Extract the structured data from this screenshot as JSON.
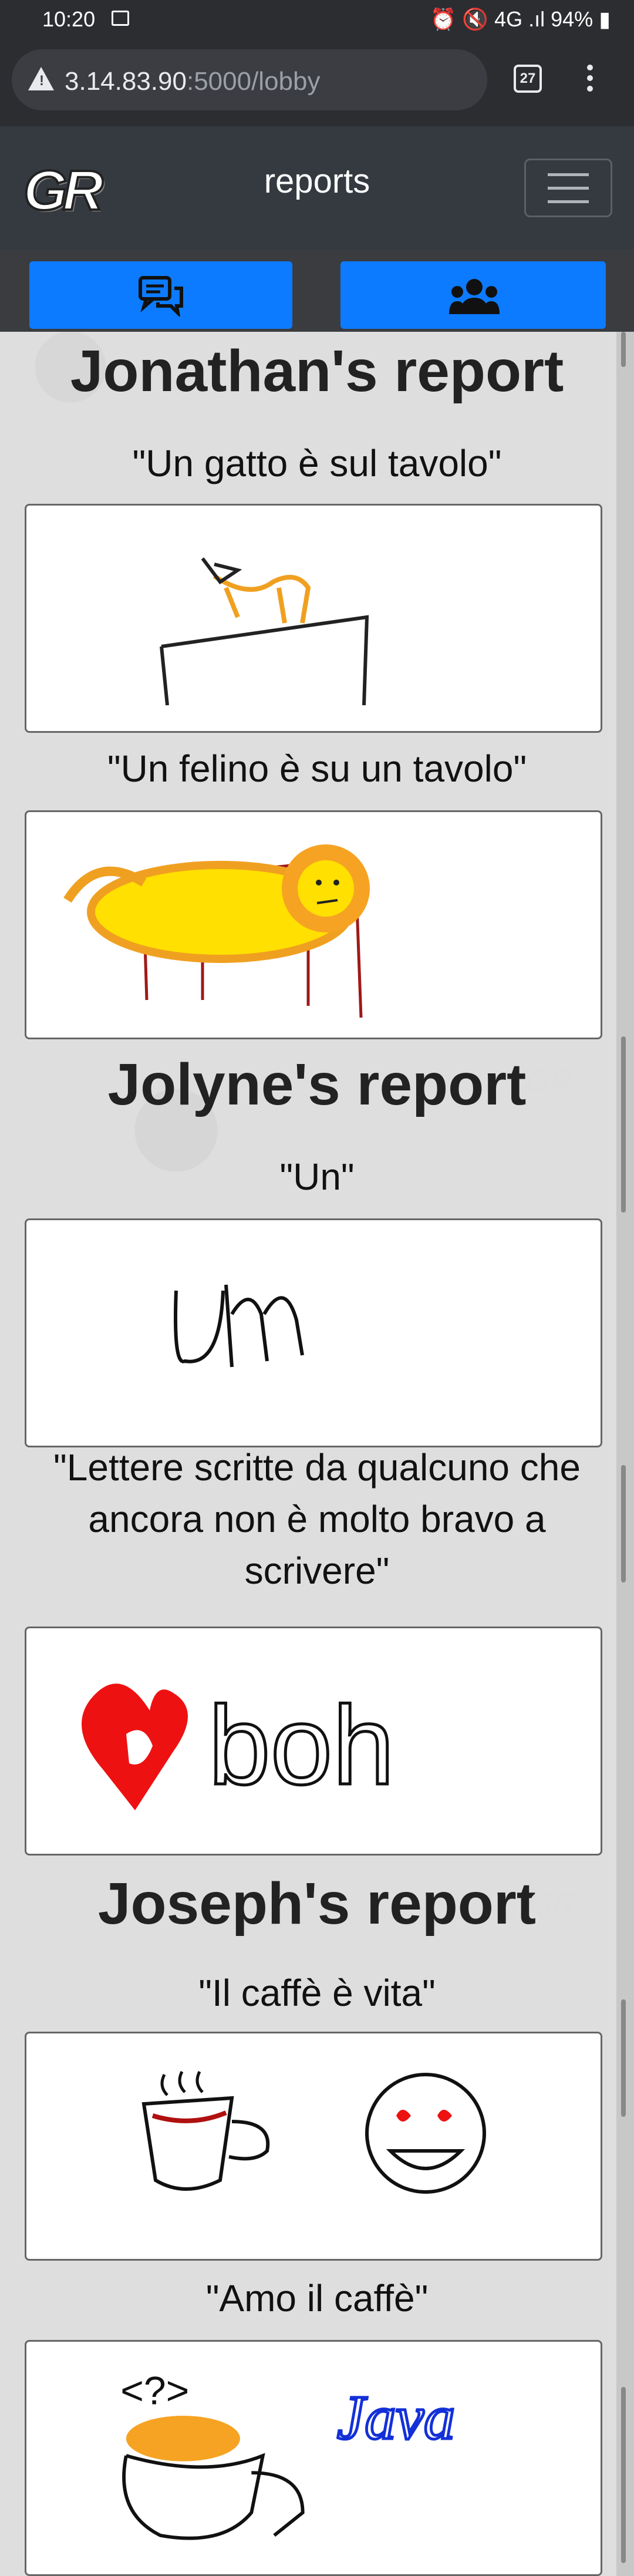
{
  "status": {
    "time": "10:20",
    "right": "⏰ 🔇 4G .ıl 94% ▮"
  },
  "browser": {
    "host": "3.14.83.90",
    "path": ":5000/lobby",
    "tab_count": "27"
  },
  "navbar": {
    "logo": "GR",
    "title": "reports"
  },
  "reports": [
    {
      "heading": "Jonathan's report",
      "entries": [
        {
          "caption": "\"Un gatto è sul tavolo\""
        },
        {
          "caption": "\"Un felino è su un tavolo\""
        }
      ]
    },
    {
      "heading": "Jolyne's report",
      "entries": [
        {
          "caption": "\"Un\""
        },
        {
          "caption": "\"Lettere scritte da qualcuno che ancora non è molto bravo a scrivere\""
        }
      ]
    },
    {
      "heading": "Joseph's report",
      "entries": [
        {
          "caption": "\"Il caffè è vita\""
        },
        {
          "caption": "\"Amo il caffè\""
        }
      ]
    }
  ],
  "drawings": {
    "d4_text": "boh",
    "d6_text": "Java",
    "d6_mark": "<?>"
  }
}
